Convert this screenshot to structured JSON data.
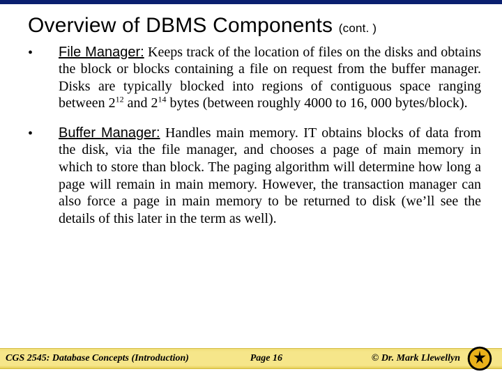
{
  "title": {
    "main": "Overview of DBMS Components",
    "cont": "(cont. )"
  },
  "items": [
    {
      "bullet": "•",
      "term": "File Manager:",
      "body_before": "  Keeps track of the location of files on the disks and obtains the block or blocks containing a file on request from the buffer manager.  Disks are typically blocked into regions of contiguous space ranging between 2",
      "sup1": "12",
      "mid": " and 2",
      "sup2": "14",
      "body_after": " bytes (between roughly 4000 to 16, 000 bytes/block)."
    },
    {
      "bullet": "•",
      "term": "Buffer Manager:",
      "body": "  Handles main memory.  IT obtains blocks of data from the disk, via the file manager, and chooses a page of main memory in which to store than block.  The paging algorithm will determine how long a page will remain in main memory.  However, the transaction manager can also force a page in main memory to be returned to disk (we’ll see the details of this later in the term as well)."
    }
  ],
  "footer": {
    "left": "CGS 2545: Database Concepts  (Introduction)",
    "center": "Page 16",
    "right": "© Dr. Mark Llewellyn"
  }
}
